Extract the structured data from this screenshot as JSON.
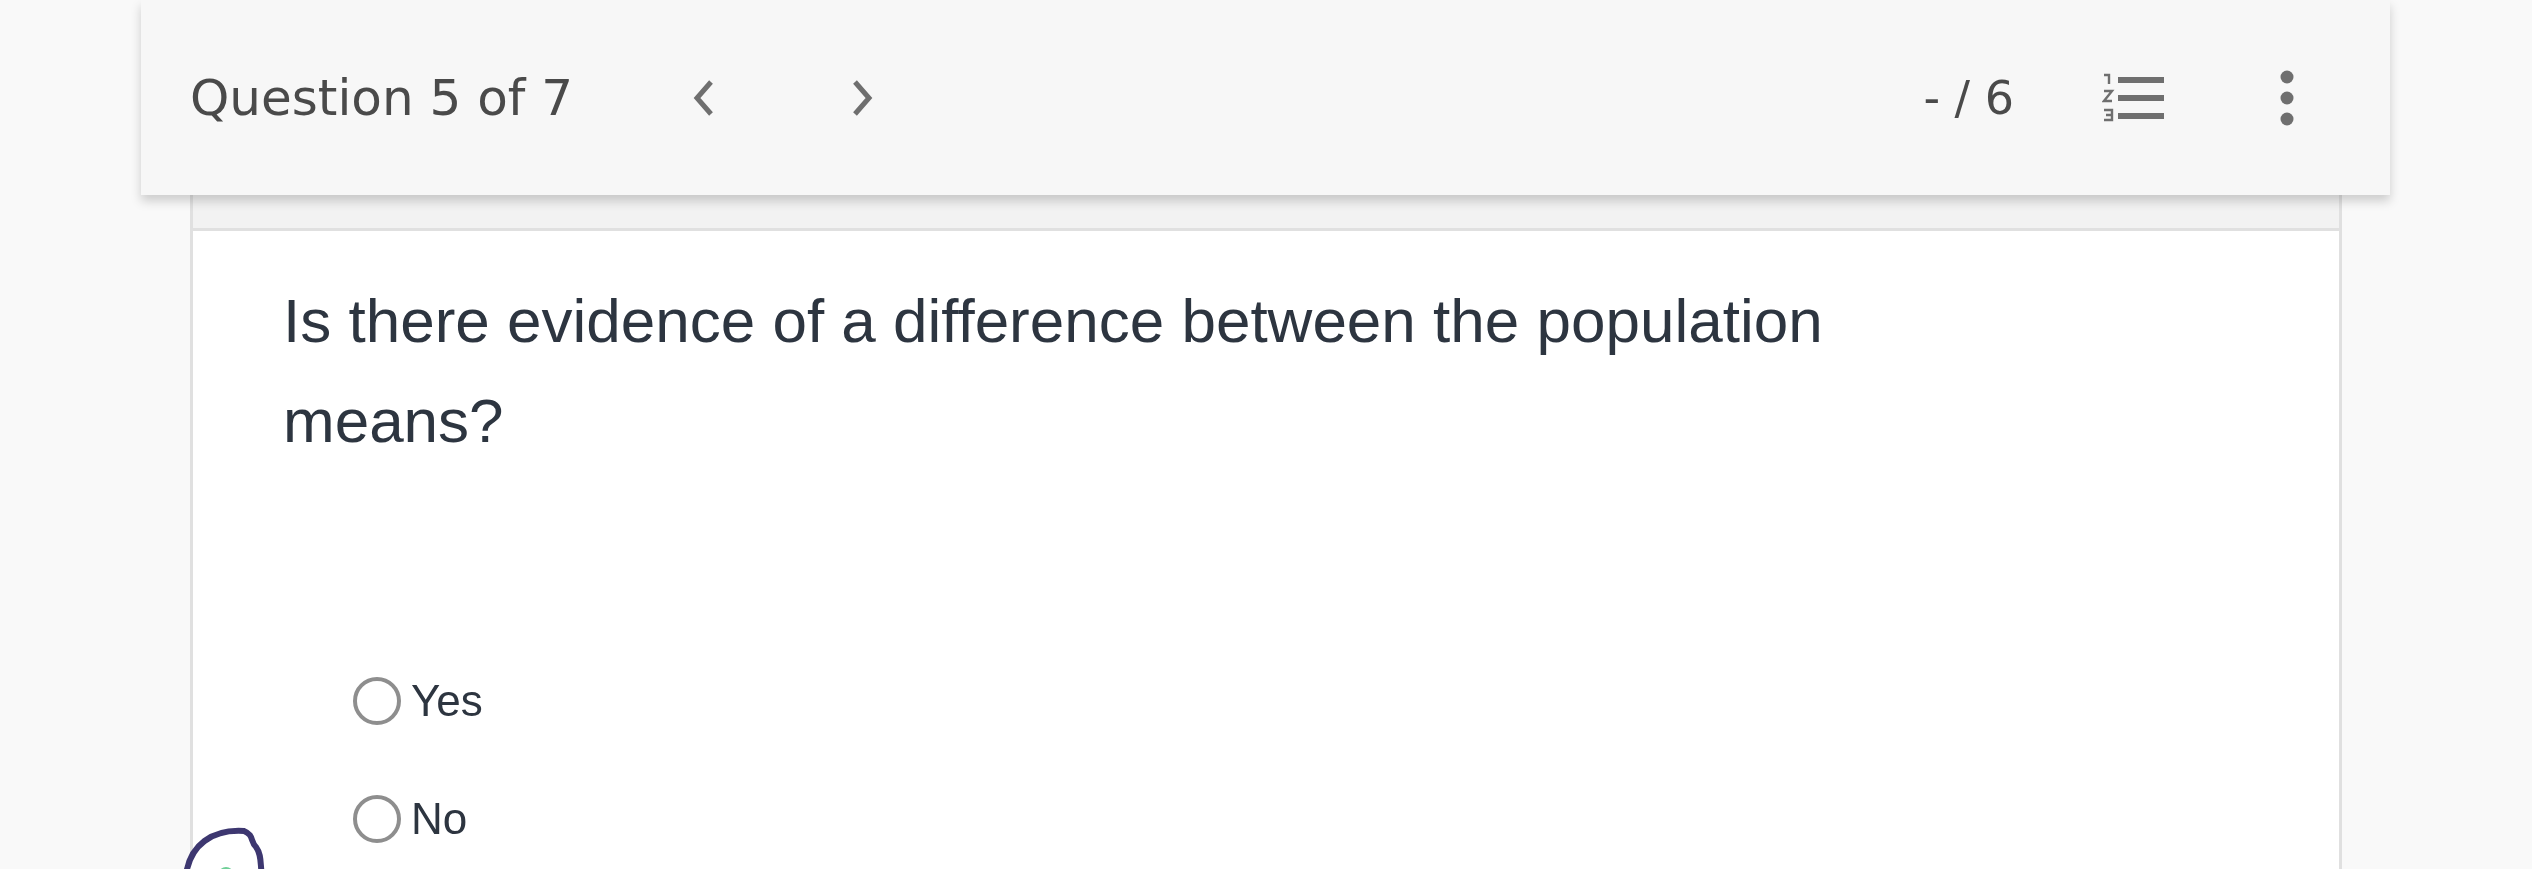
{
  "header": {
    "title": "Question 5 of 7",
    "score": "- / 6"
  },
  "question": {
    "text": "Is there evidence of a difference between the population means?",
    "options": [
      {
        "label": "Yes",
        "selected": false
      },
      {
        "label": "No",
        "selected": false
      }
    ]
  }
}
